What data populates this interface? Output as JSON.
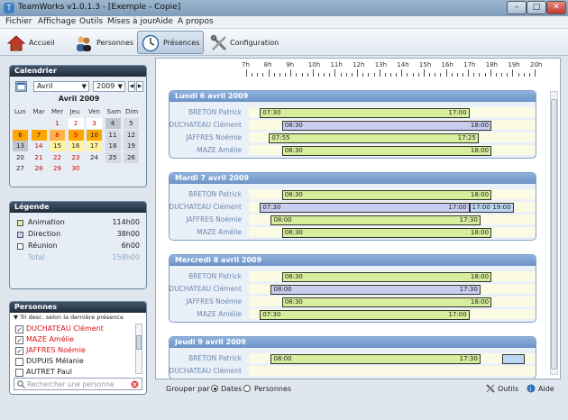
{
  "window": {
    "title": "TeamWorks v1.0.1.3 - [Exemple - Copie]",
    "minimize": "–",
    "maximize": "□",
    "close": "✕"
  },
  "menu": [
    "Fichier",
    "Affichage",
    "Outils",
    "Mises à jour",
    "Aide",
    "A propos"
  ],
  "toolbar": {
    "accueil": "Accueil",
    "personnes": "Personnes",
    "presences": "Présences",
    "configuration": "Configuration"
  },
  "calendar": {
    "title": "Calendrier",
    "month": "Avril",
    "year": "2009",
    "heading": "Avril 2009",
    "weekdays": [
      "Lun",
      "Mar",
      "Mer",
      "Jeu",
      "Ven",
      "Sam",
      "Dim"
    ],
    "weeks": [
      [
        "",
        "",
        "1",
        "2",
        "3",
        "4",
        "5"
      ],
      [
        "6",
        "7",
        "8",
        "9",
        "10",
        "11",
        "12"
      ],
      [
        "13",
        "14",
        "15",
        "16",
        "17",
        "18",
        "19"
      ],
      [
        "20",
        "21",
        "22",
        "23",
        "24",
        "25",
        "26"
      ],
      [
        "27",
        "28",
        "29",
        "30",
        "",
        "",
        ""
      ]
    ]
  },
  "legend": {
    "title": "Légende",
    "items": [
      {
        "name": "Animation",
        "hours": "114h00",
        "color": "#d7ee9c"
      },
      {
        "name": "Direction",
        "hours": "38h00",
        "color": "#c9cdf0"
      },
      {
        "name": "Réunion",
        "hours": "6h00",
        "color": "#ffffff"
      },
      {
        "name": "Total",
        "hours": "158h00",
        "color": ""
      }
    ]
  },
  "persons": {
    "title": "Personnes",
    "sort_label": "▼ Tri desc. selon la dernière présence",
    "items": [
      {
        "name": "DUCHATEAU Clément",
        "checked": true,
        "red": true
      },
      {
        "name": "MAZE Amélie",
        "checked": true,
        "red": true
      },
      {
        "name": "JAFFRES Noémie",
        "checked": true,
        "red": true
      },
      {
        "name": "DUPUIS  Mélanie",
        "checked": false,
        "red": false
      },
      {
        "name": "AUTRET Paul",
        "checked": false,
        "red": false
      }
    ],
    "search_placeholder": "Rechercher une personne"
  },
  "timeline": {
    "hours": [
      "7h",
      "8h",
      "9h",
      "10h",
      "11h",
      "12h",
      "13h",
      "14h",
      "15h",
      "16h",
      "17h",
      "18h",
      "19h",
      "20h"
    ],
    "days": [
      {
        "title": "Lundi 6 avril 2009",
        "rows": [
          {
            "person": "BRETON Patrick",
            "bars": [
              {
                "start": "07:30",
                "end": "17:00",
                "type": "g"
              }
            ]
          },
          {
            "person": "DUCHATEAU Clément",
            "bars": [
              {
                "start": "08:30",
                "end": "18:00",
                "type": "b"
              }
            ]
          },
          {
            "person": "JAFFRES Noémie",
            "bars": [
              {
                "start": "07:55",
                "end": "17:25",
                "type": "g"
              }
            ]
          },
          {
            "person": "MAZE Amélie",
            "bars": [
              {
                "start": "08:30",
                "end": "18:00",
                "type": "g"
              }
            ]
          }
        ]
      },
      {
        "title": "Mardi 7 avril 2009",
        "rows": [
          {
            "person": "BRETON Patrick",
            "bars": [
              {
                "start": "08:30",
                "end": "18:00",
                "type": "g"
              }
            ]
          },
          {
            "person": "DUCHATEAU Clément",
            "bars": [
              {
                "start": "07:30",
                "end": "17:00",
                "type": "b"
              },
              {
                "start": "17:00",
                "end": "19:00",
                "type": "lb"
              }
            ]
          },
          {
            "person": "JAFFRES Noémie",
            "bars": [
              {
                "start": "08:00",
                "end": "17:30",
                "type": "g"
              }
            ]
          },
          {
            "person": "MAZE Amélie",
            "bars": [
              {
                "start": "08:30",
                "end": "18:00",
                "type": "g"
              }
            ]
          }
        ]
      },
      {
        "title": "Mercredi 8 avril 2009",
        "rows": [
          {
            "person": "BRETON Patrick",
            "bars": [
              {
                "start": "08:30",
                "end": "18:00",
                "type": "g"
              }
            ]
          },
          {
            "person": "DUCHATEAU Clément",
            "bars": [
              {
                "start": "08:00",
                "end": "17:30",
                "type": "b"
              }
            ]
          },
          {
            "person": "JAFFRES Noémie",
            "bars": [
              {
                "start": "08:30",
                "end": "18:00",
                "type": "g"
              }
            ]
          },
          {
            "person": "MAZE Amélie",
            "bars": [
              {
                "start": "07:30",
                "end": "17:00",
                "type": "g"
              }
            ]
          }
        ]
      },
      {
        "title": "Jeudi 9 avril 2009",
        "rows": [
          {
            "person": "BRETON Patrick",
            "bars": [
              {
                "start": "08:00",
                "end": "17:30",
                "type": "g"
              },
              {
                "start": "",
                "end": "",
                "type": "lb",
                "from": "18:30",
                "to": "19:30"
              }
            ]
          },
          {
            "person": "DUCHATEAU Clément",
            "bars": []
          }
        ]
      }
    ]
  },
  "footer": {
    "group_label": "Grouper par :",
    "opt_dates": "Dates",
    "opt_persons": "Personnes",
    "tools": "Outils",
    "help": "Aide"
  }
}
